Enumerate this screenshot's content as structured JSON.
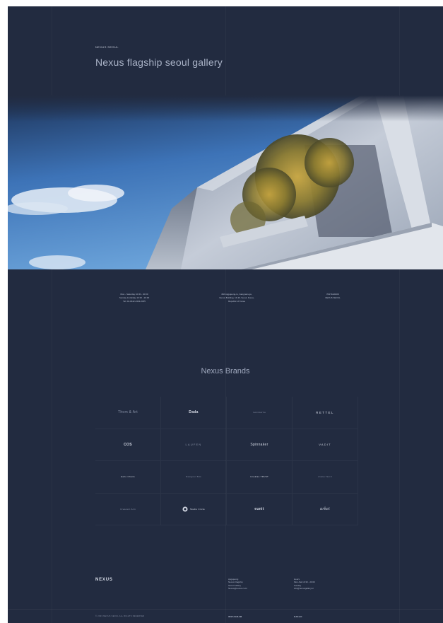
{
  "header": {
    "eyebrow": "NEXUS SEOUL",
    "title": "Nexus flagship seoul gallery"
  },
  "info": {
    "hours": [
      "Mon - Saturday 10:30 - 20:00",
      "Sunday & Holiday 10:30 - 20:00",
      "Tel. 02-3442-4332-2335"
    ],
    "address": [
      "466 Apgujeong-ro, Gangnam-gu,",
      "Nexus Building, 1F-3F, Seoul, Korea,",
      "Republic of Korea"
    ],
    "contact": [
      "INSTAGRAM",
      "NEXUS SEOUL"
    ]
  },
  "brands": {
    "title": "Nexus Brands",
    "items": [
      "Thom & Art",
      "Dada",
      "montmartre",
      "RETTEL",
      "COS",
      "LAUFEN",
      "Spinnaker",
      "VADIT",
      "Hello Chairs",
      "Designer Bits",
      "Inneklan TRUST",
      "Atelier Nord",
      "Crescent Arm",
      "Studio Circle",
      "eunit",
      "arket"
    ]
  },
  "footer": {
    "logo": "NEXUS",
    "col1": [
      "Apgujeong",
      "Nexus Flagship",
      "Seoul Gallery",
      "Nexus@nexus.co.kr"
    ],
    "col2": [
      "Hours",
      "Mon-Sat 10:30 - 20:00",
      "Sunday",
      "info@nexusgallery.kr"
    ],
    "copyright": "© 2023 NEXUS SEOUL ALL RIGHTS RESERVED",
    "link1": "INSTAGRAM",
    "link2": "KAKAO"
  }
}
